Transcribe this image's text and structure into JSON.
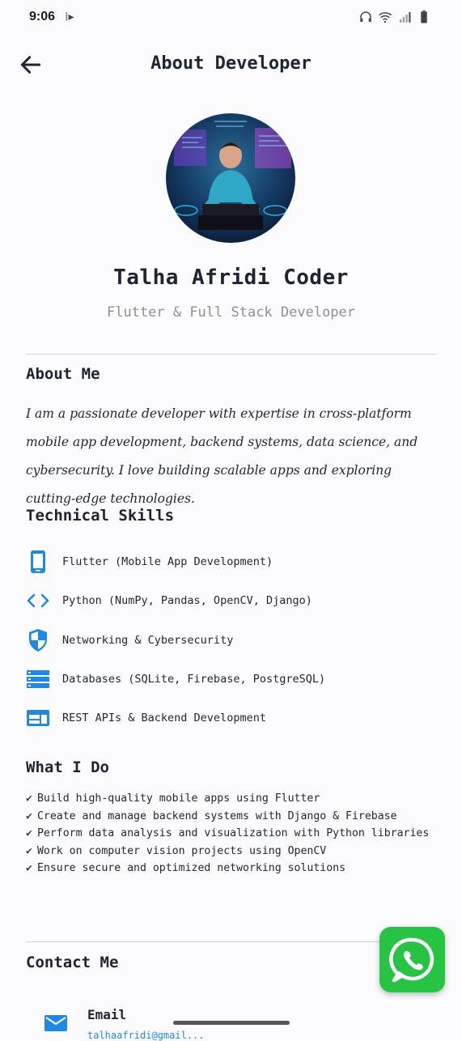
{
  "status_bar": {
    "time": "9:06",
    "left_icon": "app-notification-icon",
    "right_icons": [
      "headphones-icon",
      "wifi-icon",
      "signal-icon",
      "battery-icon"
    ]
  },
  "app_bar": {
    "title": "About Developer",
    "back_icon": "arrow-back-icon"
  },
  "profile": {
    "name": "Talha Afridi Coder",
    "role": "Flutter & Full Stack Developer"
  },
  "about": {
    "title": "About Me",
    "text": "I am a passionate developer with expertise in cross-platform mobile app development, backend systems, data science, and cybersecurity. I love building scalable apps and exploring cutting-edge technologies."
  },
  "skills": {
    "title": "Technical Skills",
    "items": [
      {
        "label": "Flutter (Mobile App Development)",
        "icon": "smartphone-icon"
      },
      {
        "label": "Python (NumPy, Pandas, OpenCV, Django)",
        "icon": "code-icon"
      },
      {
        "label": "Networking & Cybersecurity",
        "icon": "shield-icon"
      },
      {
        "label": "Databases (SQLite, Firebase, PostgreSQL)",
        "icon": "storage-icon"
      },
      {
        "label": "REST APIs & Backend Development",
        "icon": "web-icon"
      }
    ],
    "accent_color": "#1e88e5"
  },
  "what_i_do": {
    "title": "What I Do",
    "items": [
      "Build high-quality mobile apps using Flutter",
      "Create and manage backend systems with Django & Firebase",
      "Perform data analysis and visualization with Python libraries",
      "Work on computer vision projects using OpenCV",
      "Ensure secure and optimized networking solutions"
    ],
    "check_symbol": "✔"
  },
  "contact": {
    "title": "Contact Me",
    "email_label": "Email",
    "email_value": "talhaafridi@gmail..."
  },
  "fab": {
    "icon": "whatsapp-icon",
    "color": "#27c443"
  }
}
